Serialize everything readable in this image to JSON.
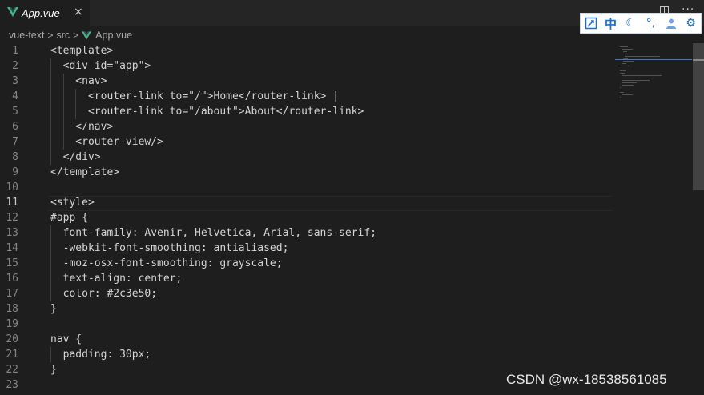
{
  "tab": {
    "label": "App.vue",
    "close": "×",
    "icon": "vue-icon"
  },
  "editor_actions": {
    "split": "split-editor-icon",
    "more": "···"
  },
  "breadcrumb": {
    "folder": "vue-text",
    "subfolder": "src",
    "file": "App.vue",
    "separator": ">"
  },
  "ime_toolbar": {
    "mode": "中",
    "moon": "☾",
    "punct": "°,",
    "user": "👤",
    "settings": "⚙"
  },
  "current_line": 11,
  "lines": [
    {
      "num": "1",
      "text": "<template>"
    },
    {
      "num": "2",
      "text": "  <div id=\"app\">"
    },
    {
      "num": "3",
      "text": "    <nav>"
    },
    {
      "num": "4",
      "text": "      <router-link to=\"/\">Home</router-link> |"
    },
    {
      "num": "5",
      "text": "      <router-link to=\"/about\">About</router-link>"
    },
    {
      "num": "6",
      "text": "    </nav>"
    },
    {
      "num": "7",
      "text": "    <router-view/>"
    },
    {
      "num": "8",
      "text": "  </div>"
    },
    {
      "num": "9",
      "text": "</template>"
    },
    {
      "num": "10",
      "text": ""
    },
    {
      "num": "11",
      "text": "<style>"
    },
    {
      "num": "12",
      "text": "#app {"
    },
    {
      "num": "13",
      "text": "  font-family: Avenir, Helvetica, Arial, sans-serif;"
    },
    {
      "num": "14",
      "text": "  -webkit-font-smoothing: antialiased;"
    },
    {
      "num": "15",
      "text": "  -moz-osx-font-smoothing: grayscale;"
    },
    {
      "num": "16",
      "text": "  text-align: center;"
    },
    {
      "num": "17",
      "text": "  color: #2c3e50;"
    },
    {
      "num": "18",
      "text": "}"
    },
    {
      "num": "19",
      "text": ""
    },
    {
      "num": "20",
      "text": "nav {"
    },
    {
      "num": "21",
      "text": "  padding: 30px;"
    },
    {
      "num": "22",
      "text": "}"
    },
    {
      "num": "23",
      "text": ""
    }
  ],
  "watermark": "CSDN @wx-18538561085",
  "colors": {
    "vue_green": "#42b883",
    "accent_blue": "#1a6fd4"
  }
}
